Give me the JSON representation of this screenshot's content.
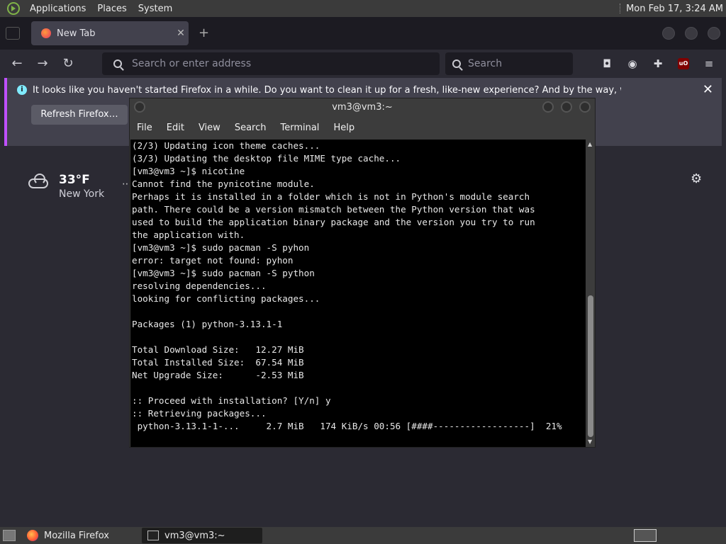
{
  "top_panel": {
    "menus": [
      "Applications",
      "Places",
      "System"
    ],
    "clock": "Mon Feb 17,  3:24 AM"
  },
  "firefox": {
    "tab_title": "New Tab",
    "url_placeholder": "Search or enter address",
    "search_placeholder": "Search",
    "notification": {
      "message": "It looks like you haven't started Firefox in a while. Do you want to clean it up for a fresh, like-new experience? And by the way, welcome back!",
      "button": "Refresh Firefox…"
    },
    "weather": {
      "temperature": "33°F",
      "city": "New York"
    }
  },
  "terminal": {
    "title": "vm3@vm3:~",
    "menus": [
      "File",
      "Edit",
      "View",
      "Search",
      "Terminal",
      "Help"
    ],
    "lines": [
      "(2/3) Updating icon theme caches...",
      "(3/3) Updating the desktop file MIME type cache...",
      "[vm3@vm3 ~]$ nicotine",
      "Cannot find the pynicotine module.",
      "Perhaps it is installed in a folder which is not in Python's module search",
      "path. There could be a version mismatch between the Python version that was",
      "used to build the application binary package and the version you try to run",
      "the application with.",
      "[vm3@vm3 ~]$ sudo pacman -S pyhon",
      "error: target not found: pyhon",
      "[vm3@vm3 ~]$ sudo pacman -S python",
      "resolving dependencies...",
      "looking for conflicting packages...",
      "",
      "Packages (1) python-3.13.1-1",
      "",
      "Total Download Size:   12.27 MiB",
      "Total Installed Size:  67.54 MiB",
      "Net Upgrade Size:      -2.53 MiB",
      "",
      ":: Proceed with installation? [Y/n] y",
      ":: Retrieving packages...",
      " python-3.13.1-1-...     2.7 MiB   174 KiB/s 00:56 [####------------------]  21%"
    ]
  },
  "taskbar": {
    "tasks": [
      "Mozilla Firefox",
      "vm3@vm3:~"
    ]
  }
}
